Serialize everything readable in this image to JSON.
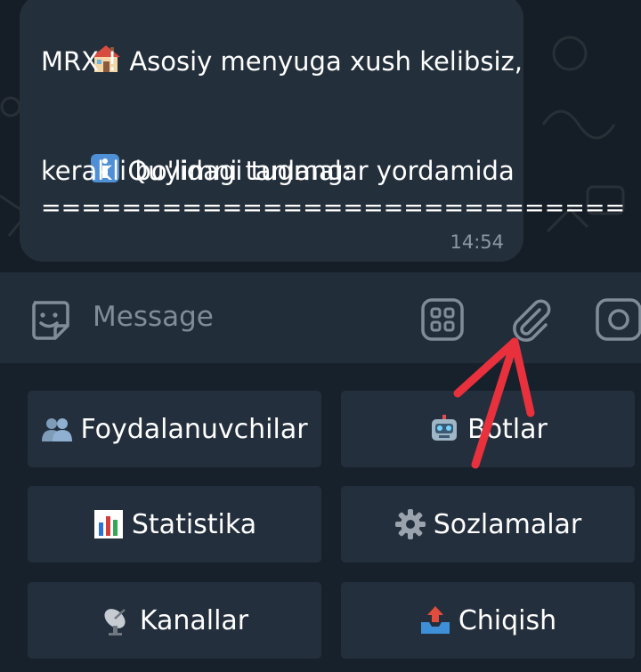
{
  "message": {
    "line1": "Asosiy menyuga xush kelibsiz,",
    "line2": "MRX !",
    "line3": "Quyidagi tugmalar yordamida",
    "line4": "kerakli bo'limni tanlang:",
    "line5": "=============================",
    "time": "14:54",
    "icons": [
      "house-emoji",
      "info-emoji"
    ]
  },
  "composer": {
    "placeholder": "Message",
    "icons": [
      "sticker-icon",
      "bot-commands-icon",
      "attach-icon",
      "camera-icon"
    ]
  },
  "keyboard": {
    "buttons": [
      {
        "label": "Foydalanuvchilar",
        "icon": "people-emoji"
      },
      {
        "label": "Botlar",
        "icon": "robot-emoji"
      },
      {
        "label": "Statistika",
        "icon": "bar-chart-emoji"
      },
      {
        "label": "Sozlamalar",
        "icon": "gear-emoji"
      },
      {
        "label": "Kanallar",
        "icon": "satellite-antenna-emoji"
      },
      {
        "label": "Chiqish",
        "icon": "outbox-tray-emoji"
      }
    ]
  },
  "colors": {
    "chat_background": "#151d26",
    "bubble": "#232f3b",
    "composer": "#222d3a",
    "keyboard_background": "#17212b",
    "button": "#242f3d",
    "annotation_arrow": "#e8313c"
  }
}
